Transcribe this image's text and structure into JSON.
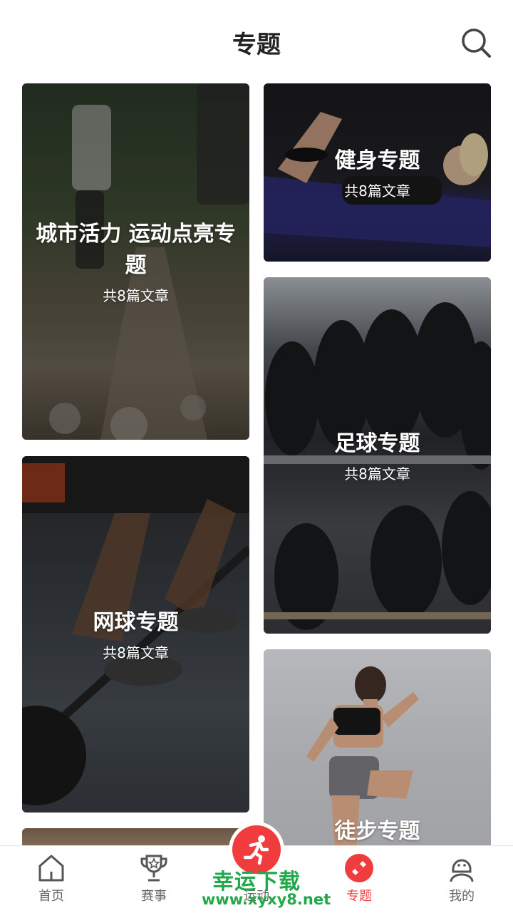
{
  "header": {
    "title": "专题"
  },
  "cards": [
    {
      "title": "城市活力 运动点亮专题",
      "subtitle": "共8篇文章"
    },
    {
      "title": "健身专题",
      "subtitle": "共8篇文章"
    },
    {
      "title": "足球专题",
      "subtitle": "共8篇文章"
    },
    {
      "title": "网球专题",
      "subtitle": "共8篇文章"
    },
    {
      "title": "徒步专题",
      "subtitle": ""
    }
  ],
  "tabs": [
    {
      "label": "首页",
      "icon": "home-icon"
    },
    {
      "label": "赛事",
      "icon": "trophy-icon"
    },
    {
      "label": "运动",
      "icon": "run-icon"
    },
    {
      "label": "专题",
      "icon": "topic-icon"
    },
    {
      "label": "我的",
      "icon": "profile-icon"
    }
  ],
  "watermark": {
    "line1": "幸运下载",
    "line2": "www.xyxy8.net"
  },
  "colors": {
    "accent": "#f03c3c",
    "watermark": "#22a84a"
  }
}
